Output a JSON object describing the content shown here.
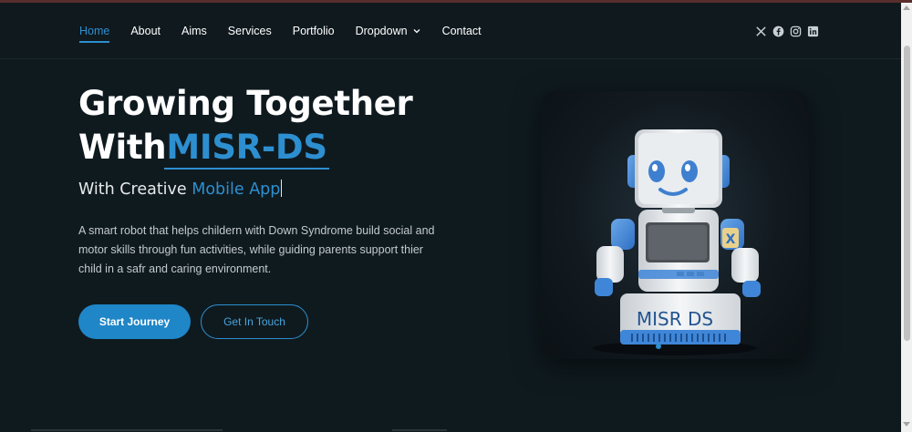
{
  "nav": {
    "items": [
      {
        "label": "Home",
        "active": true
      },
      {
        "label": "About"
      },
      {
        "label": "Aims"
      },
      {
        "label": "Services"
      },
      {
        "label": "Portfolio"
      },
      {
        "label": "Dropdown",
        "has_chevron": true
      },
      {
        "label": "Contact"
      }
    ],
    "socials": [
      "x-icon",
      "facebook-icon",
      "instagram-icon",
      "linkedin-icon"
    ]
  },
  "hero": {
    "title_line1": "Growing Together",
    "title_line2_prefix": "With",
    "title_brand": "MISR-DS",
    "subtitle_prefix": "With Creative ",
    "subtitle_highlight": "Mobile App",
    "description": "A smart robot that helps childern with Down Syndrome build social and motor skills through fun activities, while guiding parents support thier child in a safr and caring environment.",
    "primary_button": "Start Journey",
    "secondary_button": "Get In Touch",
    "robot_label": "MISR DS"
  },
  "colors": {
    "accent": "#2d8fd0",
    "background": "#0f1a1f"
  }
}
